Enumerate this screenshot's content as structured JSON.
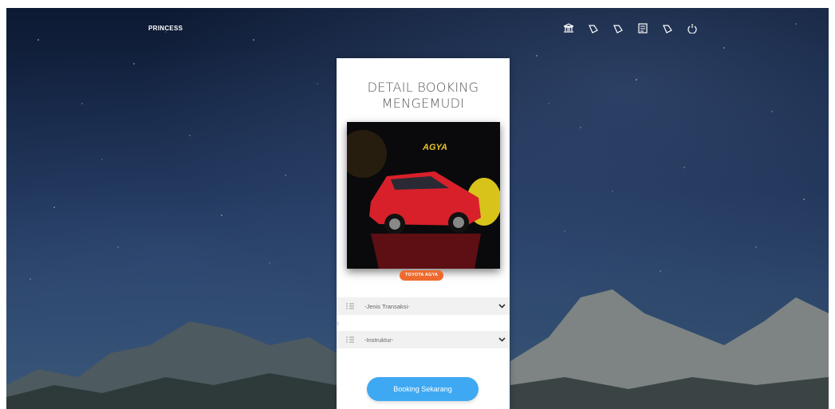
{
  "header": {
    "brand": "PRINCESS",
    "icons": [
      "bank-icon",
      "ticket-icon",
      "ticket-icon",
      "newspaper-icon",
      "ticket-icon",
      "power-icon"
    ]
  },
  "card": {
    "title_line1": "DETAIL BOOKING",
    "title_line2": "MENGEMUDI",
    "photo_text": "AGYA",
    "car_name": "TOYOTA AGYA",
    "side_caret": "<",
    "select_transaksi": "-Jenis Transaksi-",
    "select_instruktur": "-Instruktur-",
    "button_label": "Booking Sekarang"
  },
  "colors": {
    "accent": "#3ea9f2",
    "badge": "#ef6a2e",
    "car": "#d8202a"
  }
}
